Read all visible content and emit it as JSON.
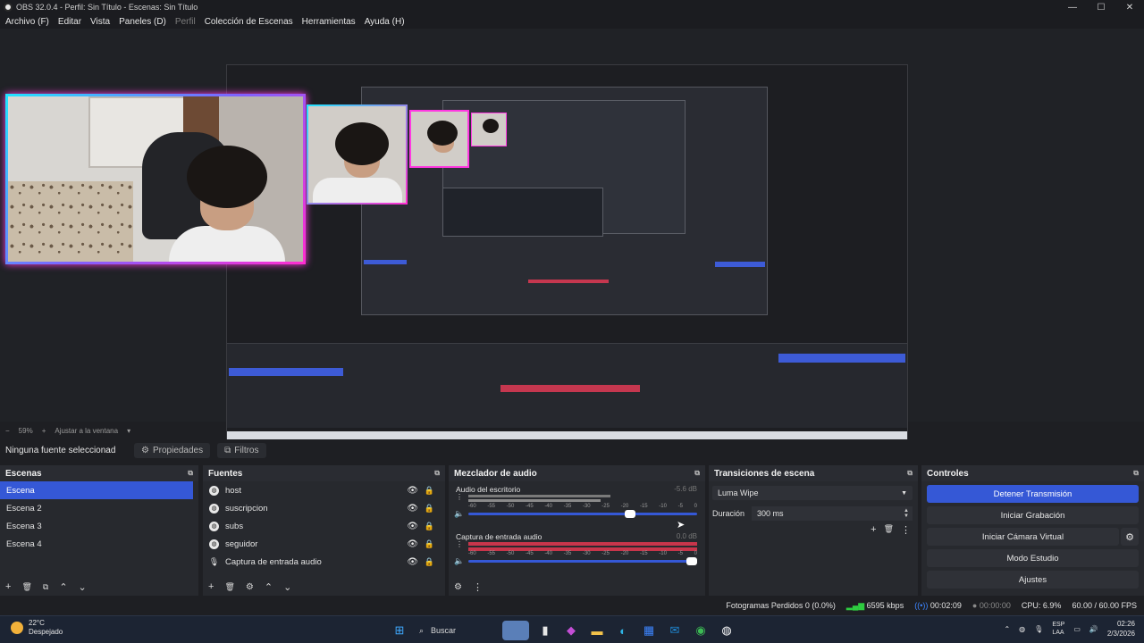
{
  "window": {
    "title": "OBS 32.0.4 - Perfil: Sin Título - Escenas: Sin Título",
    "minimize": "—",
    "maximize": "☐",
    "close": "✕"
  },
  "menu": [
    "Archivo (F)",
    "Editar",
    "Vista",
    "Paneles (D)",
    "Perfil",
    "Colección de Escenas",
    "Herramientas",
    "Ayuda (H)"
  ],
  "zoom": {
    "minus": "−",
    "level": "59%",
    "plus": "+",
    "fit_label": "Ajustar a la ventana",
    "dropdown": "▾"
  },
  "source_bar": {
    "no_source": "Ninguna fuente seleccionad",
    "properties": "Propiedades",
    "filters": "Filtros"
  },
  "scenes": {
    "title": "Escenas",
    "items": [
      "Escena",
      "Escena 2",
      "Escena 3",
      "Escena 4"
    ],
    "selected": "Escena"
  },
  "sources": {
    "title": "Fuentes",
    "items": [
      {
        "name": "host",
        "type": "browser"
      },
      {
        "name": "suscripcion",
        "type": "browser"
      },
      {
        "name": "subs",
        "type": "browser"
      },
      {
        "name": "seguidor",
        "type": "browser"
      },
      {
        "name": "Captura de entrada audio",
        "type": "mic"
      }
    ]
  },
  "mixer": {
    "title": "Mezclador de audio",
    "tracks": [
      {
        "name": "Audio del escritorio",
        "db": "-5.6 dB",
        "level": 0.73,
        "meter_color": "#7a7a7a"
      },
      {
        "name": "Captura de entrada audio",
        "db": "0.0 dB",
        "level": 1.0,
        "meter_color": "#c8354b"
      }
    ],
    "ticks": [
      "-60",
      "-55",
      "-50",
      "-45",
      "-40",
      "-35",
      "-30",
      "-25",
      "-20",
      "-15",
      "-10",
      "-5",
      "0"
    ]
  },
  "transitions": {
    "title": "Transiciones de escena",
    "selected": "Luma Wipe",
    "duration_label": "Duración",
    "duration_value": "300 ms"
  },
  "controls": {
    "title": "Controles",
    "stop_stream": "Detener Transmisión",
    "start_record": "Iniciar Grabación",
    "start_vcam": "Iniciar Cámara Virtual",
    "studio_mode": "Modo Estudio",
    "settings": "Ajustes"
  },
  "status": {
    "dropped_frames": "Fotogramas Perdidos 0 (0.0%)",
    "bitrate": "6595 kbps",
    "stream_time": "00:02:09",
    "record_time": "00:00:00",
    "cpu": "CPU: 6.9%",
    "fps": "60.00 / 60.00 FPS"
  },
  "taskbar": {
    "weather_temp": "22°C",
    "weather_desc": "Despejado",
    "search": "Buscar",
    "lang_top": "ESP",
    "lang_bottom": "LAA",
    "time": "02:26",
    "date": "2/3/2026"
  },
  "icons": {
    "undock": "⧉",
    "add": "+",
    "remove": "🗑",
    "filter": "⧉",
    "up": "⌃",
    "down": "⌄",
    "gear": "⚙",
    "eye": "👁",
    "lock": "🔒",
    "menu_dots": "⋮",
    "chevron": "⌄",
    "speaker": "🔈",
    "mic": "🎙"
  },
  "colors": {
    "accent": "#3558d6",
    "record_red": "#c8354b",
    "signal_green": "#2ecc40"
  }
}
